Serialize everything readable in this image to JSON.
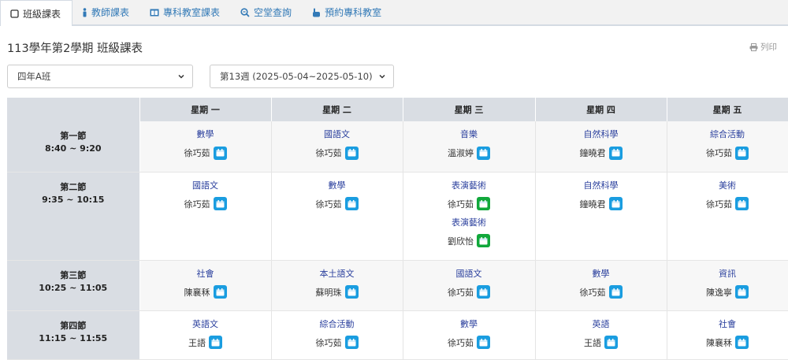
{
  "tabs": [
    {
      "label": "班級課表",
      "icon": "square-edit-icon",
      "active": true
    },
    {
      "label": "教師課表",
      "icon": "person-icon",
      "active": false
    },
    {
      "label": "專科教室課表",
      "icon": "columns-icon",
      "active": false
    },
    {
      "label": "空堂查詢",
      "icon": "zoom-icon",
      "active": false
    },
    {
      "label": "預約專科教室",
      "icon": "hand-pointer-icon",
      "active": false
    }
  ],
  "header": {
    "title": "113學年第2學期 班級課表",
    "print_label": "列印"
  },
  "filters": {
    "class_value": "四年A班",
    "week_value": "第13週 (2025-05-04~2025-05-10)"
  },
  "colors": {
    "link_blue": "#337ab7",
    "subject_text": "#2a3f9d",
    "calendar_blue": "#1a9de0",
    "calendar_green": "#11a83b",
    "highlight": "#ffe600",
    "header_bg": "#d9dde3"
  },
  "table": {
    "days": [
      "星期 一",
      "星期 二",
      "星期 三",
      "星期 四",
      "星期 五"
    ],
    "periods": [
      {
        "name": "第一節",
        "time": "8:40 ~ 9:20",
        "cells": [
          [
            {
              "subject": "數學",
              "teacher": "徐巧茹"
            }
          ],
          [
            {
              "subject": "國語文",
              "teacher": "徐巧茹"
            }
          ],
          [
            {
              "subject": "音樂",
              "teacher": "溫淑婷"
            }
          ],
          [
            {
              "subject": "自然科學",
              "teacher": "鐘曉君"
            }
          ],
          [
            {
              "subject": "綜合活動",
              "teacher": "徐巧茹"
            }
          ]
        ]
      },
      {
        "name": "第二節",
        "time": "9:35 ~ 10:15",
        "cells": [
          [
            {
              "subject": "國語文",
              "teacher": "徐巧茹"
            }
          ],
          [
            {
              "subject": "數學",
              "teacher": "徐巧茹"
            }
          ],
          [
            {
              "subject": "表演藝術",
              "teacher": "徐巧茹"
            },
            {
              "subject": "表演藝術",
              "teacher": "劉欣怡"
            }
          ],
          [
            {
              "subject": "自然科學",
              "teacher": "鐘曉君"
            }
          ],
          [
            {
              "subject": "美術",
              "teacher": "徐巧茹"
            }
          ]
        ]
      },
      {
        "name": "第三節",
        "time": "10:25 ~ 11:05",
        "cells": [
          [
            {
              "subject": "社會",
              "teacher": "陳襄秝"
            }
          ],
          [
            {
              "subject": "本土語文",
              "teacher": "蘇明珠"
            }
          ],
          [
            {
              "subject": "國語文",
              "teacher": "徐巧茹"
            }
          ],
          [
            {
              "subject": "數學",
              "teacher": "徐巧茹"
            }
          ],
          [
            {
              "subject": "資訊",
              "teacher": "陳逸寧"
            }
          ]
        ]
      },
      {
        "name": "第四節",
        "time": "11:15 ~ 11:55",
        "cells": [
          [
            {
              "subject": "英語文",
              "teacher": "王語"
            }
          ],
          [
            {
              "subject": "綜合活動",
              "teacher": "徐巧茹"
            }
          ],
          [
            {
              "subject": "數學",
              "teacher": "徐巧茹"
            }
          ],
          [
            {
              "subject": "英語",
              "teacher": "王語"
            }
          ],
          [
            {
              "subject": "社會",
              "teacher": "陳襄秝"
            }
          ]
        ]
      }
    ]
  }
}
